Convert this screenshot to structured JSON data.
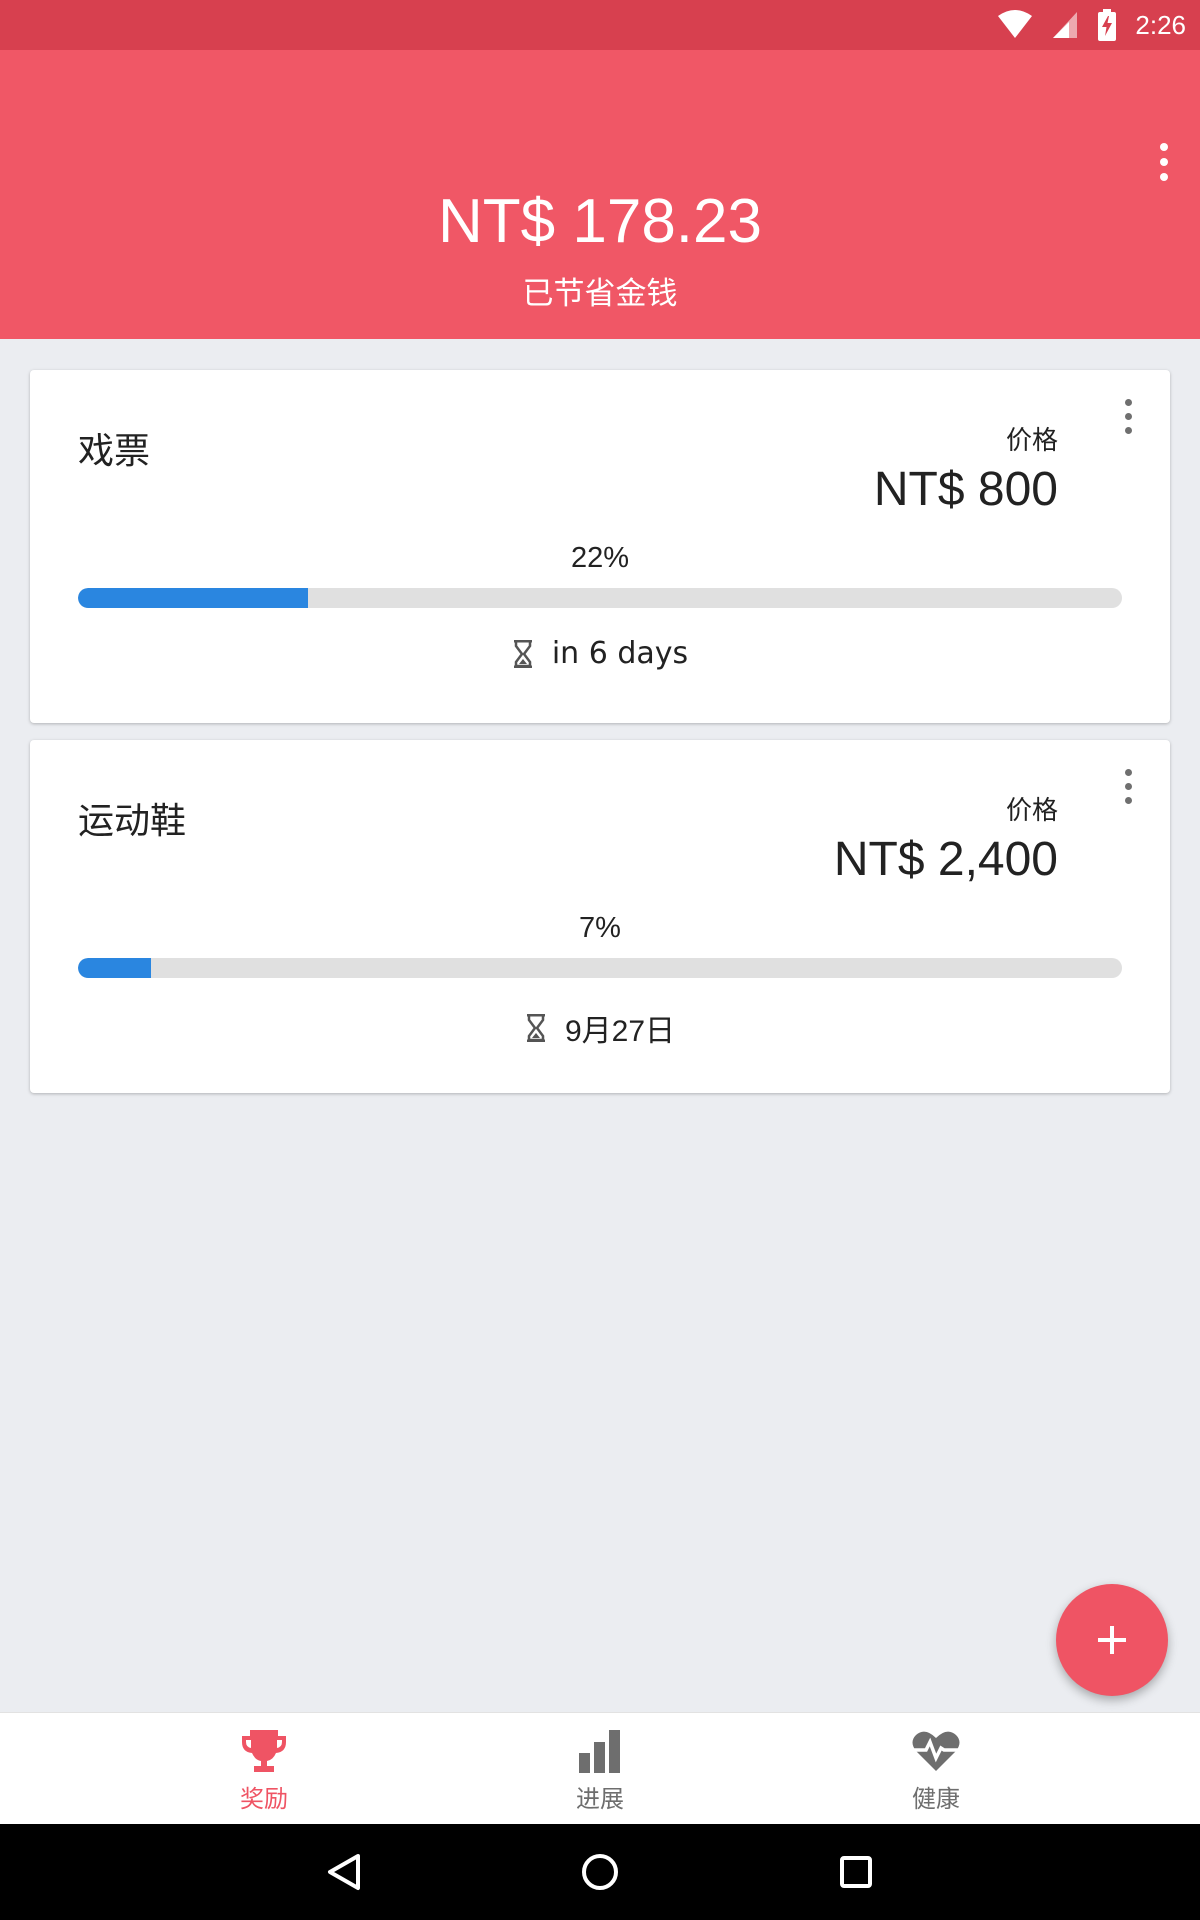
{
  "status_bar": {
    "time": "2:26",
    "icons": [
      "wifi-icon",
      "cell-signal-icon",
      "battery-charging-icon"
    ]
  },
  "header": {
    "amount": "NT$ 178.23",
    "caption": "已节省金钱",
    "menu_icon": "more-vert-icon"
  },
  "goals": [
    {
      "title": "戏票",
      "price_label": "价格",
      "price": "NT$ 800",
      "progress_text": "22%",
      "progress": 0.22,
      "eta": "in 6 days",
      "eta_icon": "hourglass-icon"
    },
    {
      "title": "运动鞋",
      "price_label": "价格",
      "price": "NT$ 2,400",
      "progress_text": "7%",
      "progress": 0.07,
      "eta": "9月27日",
      "eta_icon": "hourglass-icon"
    }
  ],
  "fab": {
    "icon": "plus-icon"
  },
  "bottom_nav": [
    {
      "label": "奖励",
      "icon": "trophy-icon",
      "active": true
    },
    {
      "label": "进展",
      "icon": "bar-chart-icon",
      "active": false
    },
    {
      "label": "健康",
      "icon": "heart-pulse-icon",
      "active": false
    }
  ],
  "colors": {
    "status_bar": "#d7404f",
    "header": "#f05766",
    "accent": "#ef5464",
    "progress": "#2a86e0",
    "nav_inactive": "#6e6e6e"
  }
}
